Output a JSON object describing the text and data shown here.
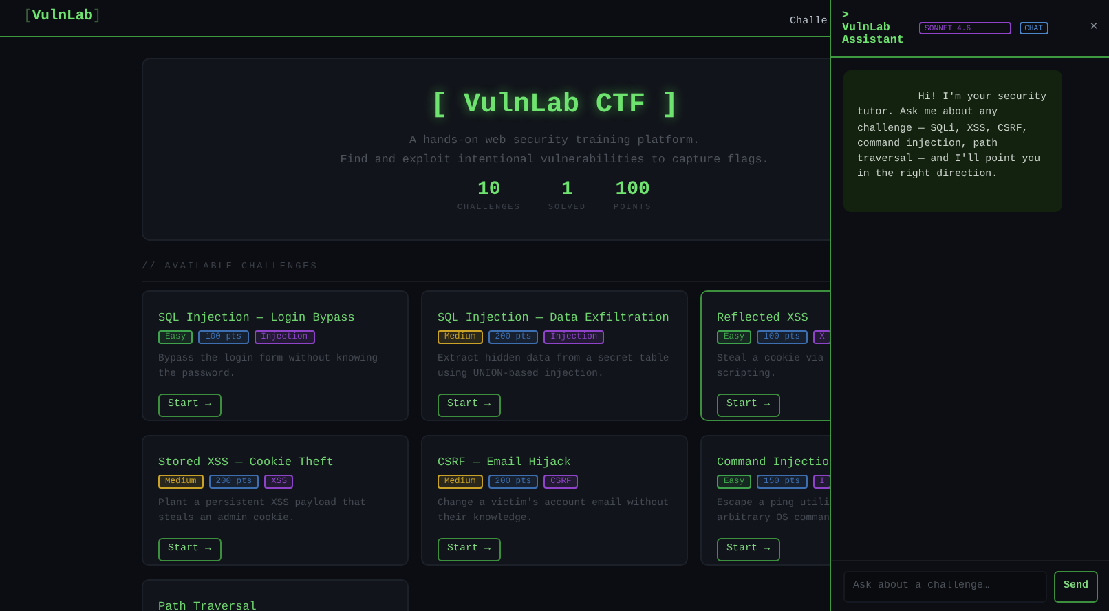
{
  "nav": {
    "brand_open": "[",
    "brand": "VulnLab",
    "brand_close": "]",
    "links": [
      {
        "label": "Challe"
      }
    ]
  },
  "hero": {
    "title": "[ VulnLab CTF ]",
    "subtitle": [
      "A hands-on web security training platform.",
      "Find and exploit intentional vulnerabilities to capture flags."
    ],
    "stats": [
      {
        "value": "10",
        "label": "CHALLENGES"
      },
      {
        "value": "1",
        "label": "SOLVED"
      },
      {
        "value": "100",
        "label": "POINTS"
      }
    ]
  },
  "section_label": "// AVAILABLE CHALLENGES",
  "challenges": [
    {
      "title": "SQL Injection — Login Bypass",
      "solved": false,
      "tags": [
        {
          "text": "Easy",
          "color": "#3fa34d"
        },
        {
          "text": "100 pts",
          "color": "#3d6fb0"
        },
        {
          "text": "Injection",
          "color": "#8e44c9"
        }
      ],
      "description": [
        "Bypass the login form without knowing",
        "the password."
      ],
      "button": "Start →"
    },
    {
      "title": "SQL Injection — Data Exfiltration",
      "solved": false,
      "tags": [
        {
          "text": "Medium",
          "color": "#c9a227"
        },
        {
          "text": "200 pts",
          "color": "#3d6fb0"
        },
        {
          "text": "Injection",
          "color": "#8e44c9"
        }
      ],
      "description": [
        "Extract hidden data from a secret table",
        "using UNION-based injection."
      ],
      "button": "Start →"
    },
    {
      "title": "Reflected XSS",
      "solved": true,
      "tags": [
        {
          "text": "Easy",
          "color": "#3fa34d"
        },
        {
          "text": "100 pts",
          "color": "#3d6fb0"
        },
        {
          "text": "X",
          "color": "#8e44c9"
        }
      ],
      "description": [
        "Steal a cookie via",
        "scripting."
      ],
      "button": "Start →"
    },
    {
      "title": "Stored XSS — Cookie Theft",
      "solved": false,
      "tags": [
        {
          "text": "Medium",
          "color": "#c9a227"
        },
        {
          "text": "200 pts",
          "color": "#3d6fb0"
        },
        {
          "text": "XSS",
          "color": "#8e44c9"
        }
      ],
      "description": [
        "Plant a persistent XSS payload that",
        "steals an admin cookie."
      ],
      "button": "Start →"
    },
    {
      "title": "CSRF — Email Hijack",
      "solved": false,
      "tags": [
        {
          "text": "Medium",
          "color": "#c9a227"
        },
        {
          "text": "200 pts",
          "color": "#3d6fb0"
        },
        {
          "text": "CSRF",
          "color": "#8e44c9"
        }
      ],
      "description": [
        "Change a victim's account email without",
        "their knowledge."
      ],
      "button": "Start →"
    },
    {
      "title": "Command Injectio",
      "solved": false,
      "tags": [
        {
          "text": "Easy",
          "color": "#3fa34d"
        },
        {
          "text": "150 pts",
          "color": "#3d6fb0"
        },
        {
          "text": "I",
          "color": "#8e44c9"
        }
      ],
      "description": [
        "Escape a ping utili",
        "arbitrary OS comman"
      ],
      "button": "Start →"
    },
    {
      "title": "Path Traversal",
      "solved": false
    }
  ],
  "assistant": {
    "prompt": ">_",
    "title": "VulnLab Assistant",
    "model": "SONNET 4.6",
    "mode": "CHAT",
    "close": "×",
    "messages": [
      {
        "text": "Hi! I'm your security tutor. Ask me about any challenge — SQLi, XSS, CSRF, command injection, path traversal — and I'll point you in the right direction."
      }
    ],
    "input": {
      "placeholder": "Ask about a challenge…"
    },
    "send": "Send"
  }
}
